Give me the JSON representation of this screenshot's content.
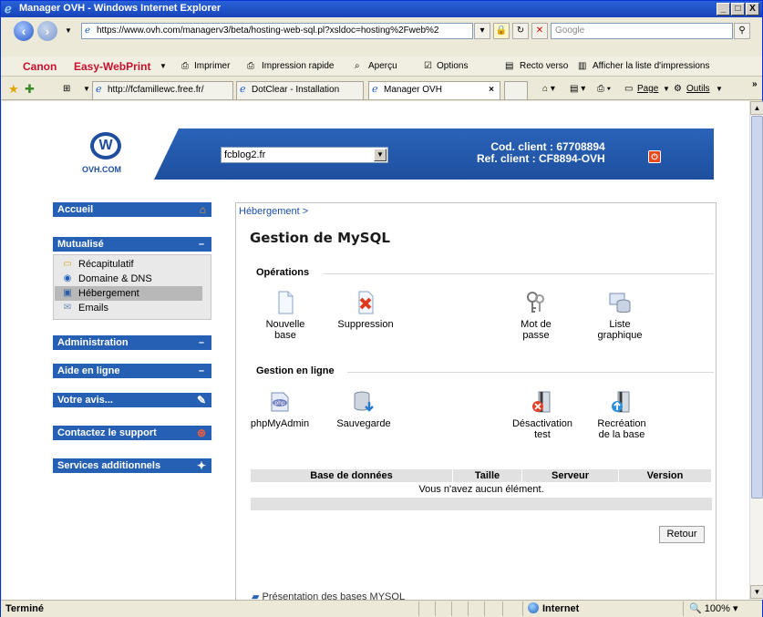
{
  "window": {
    "title": "Manager OVH - Windows Internet Explorer",
    "min": "_",
    "max": "□",
    "close": "X"
  },
  "address": {
    "url": "https://www.ovh.com/managerv3/beta/hosting-web-sql.pl?xsldoc=hosting%2Fweb%2",
    "search_placeholder": "Google"
  },
  "canon_toolbar": {
    "brand": "Canon",
    "product": "Easy-WebPrint",
    "items": [
      "Imprimer",
      "Impression rapide",
      "Aperçu",
      "Options",
      "Recto verso",
      "Afficher la liste d'impressions"
    ]
  },
  "tabs": [
    {
      "label": "http://fcfamillewc.free.fr/"
    },
    {
      "label": "DotClear - Installation"
    },
    {
      "label": "Manager OVH"
    }
  ],
  "command_bar": {
    "page": "Page",
    "tools": "Outils"
  },
  "ovh_header": {
    "logo_text": "OVH.COM",
    "domain": "fcblog2.fr",
    "client_code": "Cod. client : 67708894",
    "client_ref": "Ref. client : CF8894-OVH"
  },
  "menu": {
    "accueil": "Accueil",
    "mutualise": "Mutualisé",
    "mutualise_items": [
      "Récapitulatif",
      "Domaine & DNS",
      "Hébergement",
      "Emails"
    ],
    "administration": "Administration",
    "aide": "Aide en ligne",
    "avis": "Votre avis...",
    "support": "Contactez le support",
    "services": "Services additionnels"
  },
  "main": {
    "breadcrumb": "Hébergement >",
    "title": "Gestion de MySQL",
    "operations_title": "Opérations",
    "operations": [
      {
        "line1": "Nouvelle",
        "line2": "base"
      },
      {
        "line1": "Suppression",
        "line2": ""
      },
      {
        "line1": "Mot de",
        "line2": "passe"
      },
      {
        "line1": "Liste",
        "line2": "graphique"
      }
    ],
    "online_title": "Gestion en ligne",
    "online": [
      {
        "line1": "phpMyAdmin",
        "line2": ""
      },
      {
        "line1": "Sauvegarde",
        "line2": ""
      },
      {
        "line1": "Désactivation",
        "line2": "test"
      },
      {
        "line1": "Recréation",
        "line2": "de la base"
      }
    ],
    "table_headers": [
      "Base de données",
      "Taille",
      "Serveur",
      "Version"
    ],
    "empty_message": "Vous n'avez aucun élément.",
    "back_button": "Retour",
    "presentation_link": "Présentation des bases MYSQL"
  },
  "statusbar": {
    "text": "Terminé",
    "zone": "Internet",
    "zoom": "100%"
  }
}
